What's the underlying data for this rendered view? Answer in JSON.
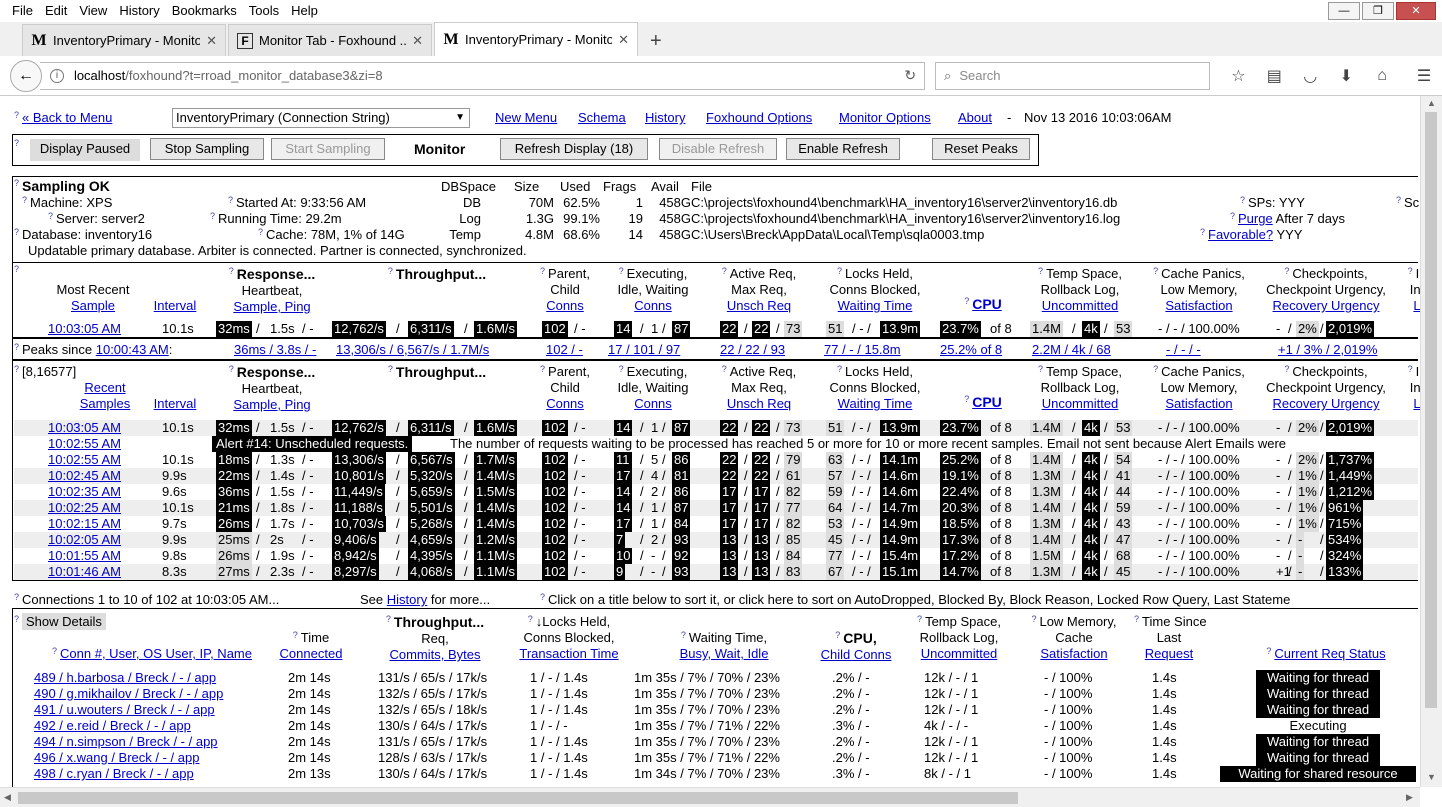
{
  "menu": [
    "File",
    "Edit",
    "View",
    "History",
    "Bookmarks",
    "Tools",
    "Help"
  ],
  "tabs": [
    {
      "icon": "M",
      "title": "InventoryPrimary - Monito..."
    },
    {
      "icon": "F",
      "title": "Monitor Tab - Foxhound ..."
    },
    {
      "icon": "M",
      "title": "InventoryPrimary - Monito..."
    }
  ],
  "url": {
    "host": "localhost",
    "rest": "/foxhound?t=rroad_monitor_database3&zi=8"
  },
  "search_placeholder": "Search",
  "top": {
    "back": "« Back to Menu",
    "select": "InventoryPrimary (Connection String)",
    "links": [
      "New Menu",
      "Schema",
      "History",
      "Foxhound Options",
      "Monitor Options",
      "About"
    ],
    "dash": "-",
    "datetime": "Nov 13 2016 10:03:06AM"
  },
  "controls": {
    "paused": "Display Paused",
    "stop": "Stop Sampling",
    "start": "Start Sampling",
    "monitor": "Monitor",
    "refresh": "Refresh Display (18)",
    "disable": "Disable Refresh",
    "enable": "Enable Refresh",
    "reset": "Reset Peaks"
  },
  "status": {
    "title": "Sampling OK",
    "machine": "Machine: XPS",
    "server": "Server: server2",
    "database": "Database: inventory16",
    "started": "Started At: 9:33:56 AM",
    "running": "Running Time: 29.2m",
    "cache": "Cache: 78M, 1% of 14G",
    "note": "Updatable primary database. Arbiter is connected. Partner is connected, synchronized.",
    "files_hdr": [
      "DBSpace",
      "Size",
      "Used",
      "Frags",
      "Avail",
      "File"
    ],
    "files": [
      [
        "DB",
        "70M",
        "62.5%",
        "1",
        "458G",
        "C:\\projects\\foxhound4\\benchmark\\HA_inventory16\\server2\\inventory16.db"
      ],
      [
        "Log",
        "1.3G",
        "99.1%",
        "19",
        "458G",
        "C:\\projects\\foxhound4\\benchmark\\HA_inventory16\\server2\\inventory16.log"
      ],
      [
        "Temp",
        "4.8M",
        "68.6%",
        "14",
        "458G",
        "C:\\Users\\Breck\\AppData\\Local\\Temp\\sqla0003.tmp"
      ]
    ],
    "sps": "SPs: YYY",
    "sc": "Sc",
    "purge": "Purge",
    "purge_after": "After 7 days",
    "favorable": "Favorable?",
    "fav_val": "YYY"
  },
  "h": {
    "response": "Response...",
    "response2": "Heartbeat,",
    "response3": "Sample, Ping",
    "throughput": "Throughput...",
    "tp2": "Req,",
    "tp3": "Commits, Bytes",
    "parent": "Parent,",
    "parent2": "Child",
    "parent3": "Conns",
    "exec": "Executing,",
    "exec2": "Idle, Waiting",
    "exec3": "Conns",
    "active": "Active Req,",
    "active2": "Max Req,",
    "active3": "Unsch Req",
    "locks": "Locks Held,",
    "locks2": "Conns Blocked,",
    "locks3": "Waiting Time",
    "cpu": "CPU",
    "temp": "Temp Space,",
    "temp2": "Rollback Log,",
    "temp3": "Uncommitted",
    "cache": "Cache Panics,",
    "cache2": "Low Memory,",
    "cache3": "Satisfaction",
    "ckpt": "Checkpoints,",
    "ckpt2": "Checkpoint Urgency,",
    "ckpt3": "Recovery Urgency",
    "int": "In",
    "int2": "Int",
    "int3": "L",
    "most": "Most Recent",
    "sample": "Sample",
    "interval": "Interval",
    "recent": "Recent",
    "samples": "Samples",
    "id": "[8,16577]"
  },
  "recent": {
    "time": "10:03:05 AM",
    "interval": "10.1s",
    "resp": "32ms",
    "hb": "1.5s",
    "ping": "-",
    "req": "12,762/s",
    "commits": "6,311/s",
    "bytes": "1.6M/s",
    "parent": "102",
    "child": "-",
    "exec": "14",
    "idle": "1",
    "wait": "87",
    "active": "22",
    "max": "22",
    "unsch": "73",
    "locks": "51",
    "blocked": "-",
    "wtime": "13.9m",
    "cpu": "23.7%",
    "of": "of 8",
    "temp": "1.4M",
    "rb": "4k",
    "unc": "53",
    "cachep": "- / - / 100.00%",
    "ck1": "-",
    "ck2": "2%",
    "ck3": "2,019%"
  },
  "peaks": {
    "label": "Peaks since",
    "since": "10:00:43 AM",
    "resp": "36ms / 3.8s / -",
    "tp": "13,306/s / 6,567/s / 1.7M/s",
    "parent": "102 / -",
    "exec": "17 / 101 / 97",
    "active": "22 / 22 / 93",
    "locks": "77 / - / 15.8m",
    "cpu": "25.2% of 8",
    "temp": "2.2M / 4k / 68",
    "cache": "- / - / -",
    "ckpt": "+1 / 3% / 2,019%"
  },
  "alert": {
    "time": "10:02:55 AM",
    "label": "Alert #14: Unscheduled requests.",
    "text": "The number of requests waiting to be processed has reached 5 or more for 10 or more recent samples. Email not sent because Alert Emails were"
  },
  "samples": [
    [
      "10:03:05 AM",
      "10.1s",
      "32ms",
      "1.5s",
      "12,762/s",
      "6,311/s",
      "1.6M/s",
      "14",
      "1",
      "87",
      "22",
      "22",
      "73",
      "51",
      "-",
      "13.9m",
      "23.7%",
      "1.4M",
      "4k",
      "53",
      "- / - / 100.00%",
      "-",
      "2%",
      "2,019%"
    ],
    [
      "10:02:55 AM",
      "10.1s",
      "18ms",
      "1.3s",
      "13,306/s",
      "6,567/s",
      "1.7M/s",
      "11",
      "5",
      "86",
      "22",
      "22",
      "79",
      "63",
      "-",
      "14.1m",
      "25.2%",
      "1.4M",
      "4k",
      "54",
      "- / - / 100.00%",
      "-",
      "2%",
      "1,737%"
    ],
    [
      "10:02:45 AM",
      "9.9s",
      "22ms",
      "1.4s",
      "10,801/s",
      "5,320/s",
      "1.4M/s",
      "17",
      "4",
      "81",
      "22",
      "22",
      "61",
      "57",
      "-",
      "14.6m",
      "19.1%",
      "1.3M",
      "4k",
      "41",
      "- / - / 100.00%",
      "-",
      "1%",
      "1,449%"
    ],
    [
      "10:02:35 AM",
      "9.6s",
      "36ms",
      "1.5s",
      "11,449/s",
      "5,659/s",
      "1.5M/s",
      "14",
      "2",
      "86",
      "17",
      "17",
      "82",
      "59",
      "-",
      "14.6m",
      "22.4%",
      "1.3M",
      "4k",
      "44",
      "- / - / 100.00%",
      "-",
      "1%",
      "1,212%"
    ],
    [
      "10:02:25 AM",
      "10.1s",
      "21ms",
      "1.8s",
      "11,188/s",
      "5,501/s",
      "1.4M/s",
      "14",
      "1",
      "87",
      "17",
      "17",
      "77",
      "64",
      "-",
      "14.7m",
      "20.3%",
      "1.4M",
      "4k",
      "59",
      "- / - / 100.00%",
      "-",
      "1%",
      "961%"
    ],
    [
      "10:02:15 AM",
      "9.7s",
      "26ms",
      "1.7s",
      "10,703/s",
      "5,268/s",
      "1.4M/s",
      "17",
      "1",
      "84",
      "17",
      "17",
      "82",
      "53",
      "-",
      "14.9m",
      "18.5%",
      "1.3M",
      "4k",
      "43",
      "- / - / 100.00%",
      "-",
      "1%",
      "715%"
    ],
    [
      "10:02:05 AM",
      "9.9s",
      "25ms",
      "2s",
      "9,406/s",
      "4,659/s",
      "1.2M/s",
      "7",
      "2",
      "93",
      "13",
      "13",
      "85",
      "45",
      "-",
      "14.9m",
      "17.3%",
      "1.4M",
      "4k",
      "47",
      "- / - / 100.00%",
      "-",
      "-",
      "534%"
    ],
    [
      "10:01:55 AM",
      "9.8s",
      "26ms",
      "1.9s",
      "8,942/s",
      "4,395/s",
      "1.1M/s",
      "10",
      "-",
      "92",
      "13",
      "13",
      "84",
      "77",
      "-",
      "15.4m",
      "17.2%",
      "1.5M",
      "4k",
      "68",
      "- / - / 100.00%",
      "-",
      "-",
      "324%"
    ],
    [
      "10:01:46 AM",
      "8.3s",
      "27ms",
      "2.3s",
      "8,297/s",
      "4,068/s",
      "1.1M/s",
      "9",
      "-",
      "93",
      "13",
      "13",
      "83",
      "67",
      "-",
      "15.1m",
      "14.7%",
      "1.3M",
      "4k",
      "45",
      "- / - / 100.00%",
      "+1",
      "-",
      "133%"
    ]
  ],
  "conns": {
    "line": "Connections 1 to 10 of 102 at 10:03:05 AM...",
    "see": "See",
    "history": "History",
    "formore": "for more...",
    "click": "Click on a title below to sort it, or click here to sort on AutoDropped, Blocked By, Block Reason, Locked Row Query, Last Stateme",
    "show": "Show Details",
    "h": {
      "conn": "Conn #, User, OS User, IP, Name",
      "time1": "Time",
      "time2": "Connected",
      "tp1": "Throughput...",
      "tp2": "Req,",
      "tp3": "Commits, Bytes",
      "lk1": "↓Locks Held,",
      "lk2": "Conns Blocked,",
      "lk3": "Transaction Time",
      "wt1": "Waiting Time,",
      "wt2": "Busy, Wait, Idle",
      "cpu1": "CPU,",
      "cpu2": "Child Conns",
      "ts1": "Temp Space,",
      "ts2": "Rollback Log,",
      "ts3": "Uncommitted",
      "lm1": "Low Memory,",
      "lm2": "Cache",
      "lm3": "Satisfaction",
      "tl1": "Time Since",
      "tl2": "Last",
      "tl3": "Request",
      "crs": "Current Req Status"
    },
    "rows": [
      [
        "489 / h.barbosa / Breck / - / app",
        "2m 14s",
        "131/s / 65/s / 17k/s",
        "1 / - / 1.4s",
        "1m 35s / 7% / 70% / 23%",
        ".2% / -",
        "12k / - / 1",
        "- / 100%",
        "1.4s",
        "Waiting for thread"
      ],
      [
        "490 / g.mikhailov / Breck / - / app",
        "2m 14s",
        "132/s / 65/s / 17k/s",
        "1 / - / 1.4s",
        "1m 35s / 7% / 70% / 23%",
        ".2% / -",
        "12k / - / 1",
        "- / 100%",
        "1.4s",
        "Waiting for thread"
      ],
      [
        "491 / u.wouters / Breck / - / app",
        "2m 14s",
        "132/s / 65/s / 18k/s",
        "1 / - / 1.4s",
        "1m 35s / 7% / 70% / 23%",
        ".2% / -",
        "12k / - / 1",
        "- / 100%",
        "1.4s",
        "Waiting for thread"
      ],
      [
        "492 / e.reid / Breck / - / app",
        "2m 14s",
        "130/s / 64/s / 17k/s",
        "1 / - / -",
        "1m 35s / 7% / 71% / 22%",
        ".3% / -",
        "4k / - / -",
        "- / 100%",
        "1.4s",
        "Executing"
      ],
      [
        "494 / n.simpson / Breck / - / app",
        "2m 14s",
        "131/s / 65/s / 17k/s",
        "1 / - / 1.4s",
        "1m 35s / 7% / 70% / 23%",
        ".2% / -",
        "12k / - / 1",
        "- / 100%",
        "1.4s",
        "Waiting for thread"
      ],
      [
        "496 / x.wang / Breck / - / app",
        "2m 14s",
        "128/s / 63/s / 17k/s",
        "1 / - / 1.4s",
        "1m 35s / 7% / 71% / 22%",
        ".2% / -",
        "12k / - / 1",
        "- / 100%",
        "1.4s",
        "Waiting for thread"
      ],
      [
        "498 / c.ryan / Breck / - / app",
        "2m 13s",
        "130/s / 64/s / 17k/s",
        "1 / - / 1.4s",
        "1m 34s / 7% / 70% / 23%",
        ".3% / -",
        "8k / - / 1",
        "- / 100%",
        "1.4s",
        "Waiting for shared resource"
      ]
    ]
  },
  "icons": {
    "back": "back-arrow-icon",
    "info": "info-icon",
    "reload": "reload-icon",
    "search": "search-icon",
    "help": "help-icon"
  }
}
